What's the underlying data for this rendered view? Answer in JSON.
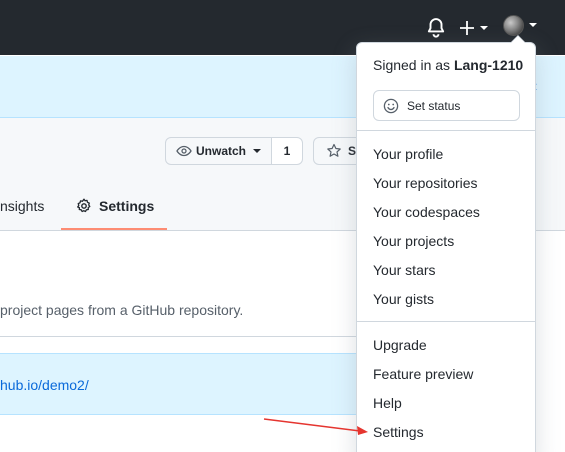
{
  "header": {
    "notifications_icon": "bell-icon",
    "create_icon": "plus-icon",
    "avatar_icon": "user-avatar"
  },
  "repo": {
    "watch_label": "Unwatch",
    "watch_count": "1",
    "star_label": "S",
    "tabs": {
      "insights": "nsights",
      "settings": "Settings"
    },
    "description": "project pages from a GitHub repository.",
    "site_url": "hub.io/demo2/"
  },
  "dropdown": {
    "signed_in_prefix": "Signed in as",
    "username": "Lang-1210",
    "set_status": "Set status",
    "group1": [
      "Your profile",
      "Your repositories",
      "Your codespaces",
      "Your projects",
      "Your stars",
      "Your gists"
    ],
    "group2": [
      "Upgrade",
      "Feature preview",
      "Help",
      "Settings"
    ]
  },
  "colors": {
    "topbar": "#24292f",
    "banner": "#ddf4ff",
    "link": "#0969da",
    "tab_underline": "#fd8c73",
    "annotation_arrow": "#e5352f"
  }
}
